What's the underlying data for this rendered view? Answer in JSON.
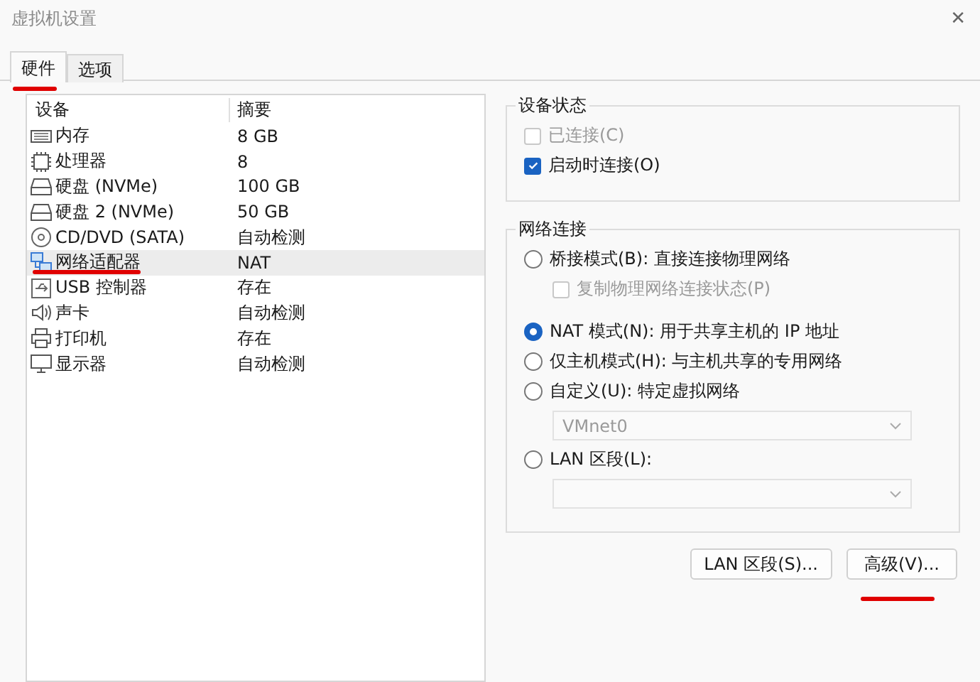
{
  "window": {
    "title": "虚拟机设置",
    "close": "✕"
  },
  "tabs": [
    {
      "label": "硬件",
      "selected": true,
      "underlined": true
    },
    {
      "label": "选项",
      "selected": false,
      "underlined": false
    }
  ],
  "devices": {
    "columns": [
      "设备",
      "摘要"
    ],
    "rows": [
      {
        "kind": "memory",
        "name": "内存",
        "summary": "8 GB",
        "selected": false,
        "underlined": false
      },
      {
        "kind": "cpu",
        "name": "处理器",
        "summary": "8",
        "selected": false,
        "underlined": false
      },
      {
        "kind": "disk",
        "name": "硬盘 (NVMe)",
        "summary": "100 GB",
        "selected": false,
        "underlined": false
      },
      {
        "kind": "disk",
        "name": "硬盘 2 (NVMe)",
        "summary": "50 GB",
        "selected": false,
        "underlined": false
      },
      {
        "kind": "cd",
        "name": "CD/DVD (SATA)",
        "summary": "自动检测",
        "selected": false,
        "underlined": false
      },
      {
        "kind": "network",
        "name": "网络适配器",
        "summary": "NAT",
        "selected": true,
        "underlined": true
      },
      {
        "kind": "usb",
        "name": "USB 控制器",
        "summary": "存在",
        "selected": false,
        "underlined": false
      },
      {
        "kind": "sound",
        "name": "声卡",
        "summary": "自动检测",
        "selected": false,
        "underlined": false
      },
      {
        "kind": "printer",
        "name": "打印机",
        "summary": "存在",
        "selected": false,
        "underlined": false
      },
      {
        "kind": "monitor",
        "name": "显示器",
        "summary": "自动检测",
        "selected": false,
        "underlined": false
      }
    ]
  },
  "device_status": {
    "title": "设备状态",
    "options": [
      {
        "label": "已连接(C)",
        "checked": false,
        "disabled": true
      },
      {
        "label": "启动时连接(O)",
        "checked": true,
        "disabled": false
      }
    ]
  },
  "network_connection": {
    "title": "网络连接",
    "items": [
      {
        "kind": "radio",
        "label": "桥接模式(B): 直接连接物理网络",
        "selected": false
      },
      {
        "kind": "checkbox",
        "label": "复制物理网络连接状态(P)",
        "checked": false,
        "disabled": true
      },
      {
        "kind": "radio",
        "label": "NAT 模式(N): 用于共享主机的 IP 地址",
        "selected": true
      },
      {
        "kind": "radio",
        "label": "仅主机模式(H): 与主机共享的专用网络",
        "selected": false
      },
      {
        "kind": "radio",
        "label": "自定义(U): 特定虚拟网络",
        "selected": false
      },
      {
        "kind": "dropdown",
        "value": "VMnet0",
        "disabled": true
      },
      {
        "kind": "radio",
        "label": "LAN 区段(L):",
        "selected": false
      },
      {
        "kind": "dropdown",
        "disabled": true
      }
    ]
  },
  "buttons": [
    {
      "label": "LAN 区段(S)...",
      "underlined": false
    },
    {
      "label": "高级(V)...",
      "underlined": true
    }
  ]
}
